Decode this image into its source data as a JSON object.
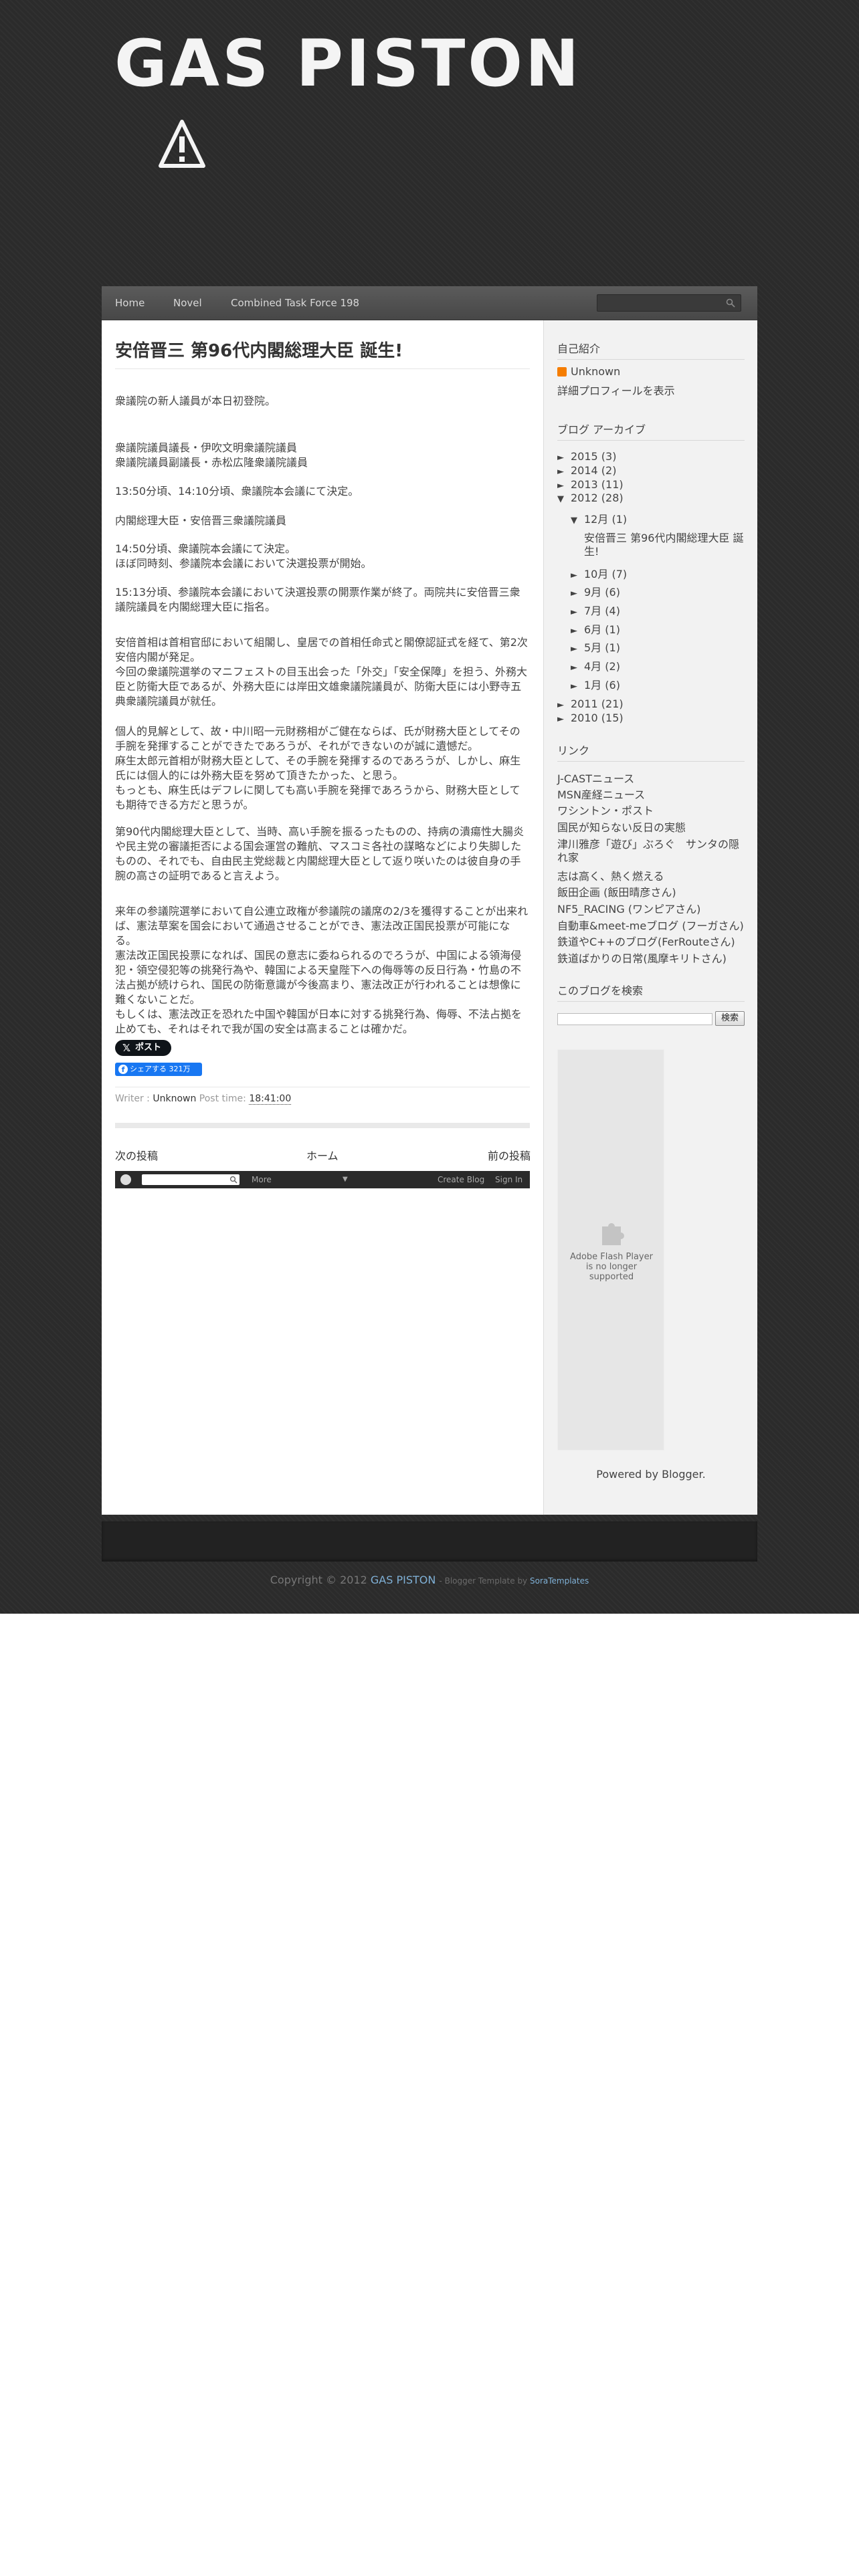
{
  "header": {
    "title": "GAS PISTON"
  },
  "nav": {
    "items": [
      "Home",
      "Novel",
      "Combined Task Force 198"
    ],
    "search_placeholder": ""
  },
  "post": {
    "title": "安倍晋三 第96代内閣総理大臣 誕生!",
    "paragraphs": [
      "衆議院の新人議員が本日初登院。",
      "衆議院議員議長・伊吹文明衆議院議員\n衆議院議員副議長・赤松広隆衆議院議員",
      "13:50分頃、14:10分頃、衆議院本会議にて決定。",
      "内閣総理大臣・安倍晋三衆議院議員",
      "14:50分頃、衆議院本会議にて決定。\nほぼ同時刻、参議院本会議において決選投票が開始。",
      "15:13分頃、参議院本会議において決選投票の開票作業が終了。両院共に安倍晋三衆議院議員を内閣総理大臣に指名。",
      "安倍首相は首相官邸において組閣し、皇居での首相任命式と閣僚認証式を経て、第2次安倍内閣が発足。\n今回の衆議院選挙のマニフェストの目玉出会った「外交」「安全保障」を担う、外務大臣と防衛大臣であるが、外務大臣には岸田文雄衆議院議員が、防衛大臣には小野寺五典衆議院議員が就任。",
      "個人的見解として、故・中川昭一元財務相がご健在ならば、氏が財務大臣としてその手腕を発揮することができたであろうが、それができないのが誠に遺憾だ。\n麻生太郎元首相が財務大臣として、その手腕を発揮するのであろうが、しかし、麻生氏には個人的には外務大臣を努めて頂きたかった、と思う。\nもっとも、麻生氏はデフレに関しても高い手腕を発揮であろうから、財務大臣としても期待できる方だと思うが。",
      "第90代内閣総理大臣として、当時、高い手腕を振るったものの、持病の潰瘍性大腸炎や民主党の審議拒否による国会運営の難航、マスコミ各社の謀略などにより失脚したものの、それでも、自由民主党総裁と内閣総理大臣として返り咲いたのは彼自身の手腕の高さの証明であると言えよう。",
      "来年の参議院選挙において自公連立政権が参議院の議席の2/3を獲得することが出来れば、憲法草案を国会において通過させることができ、憲法改正国民投票が可能になる。\n憲法改正国民投票になれば、国民の意志に委ねられるのでろうが、中国による領海侵犯・領空侵犯等の挑発行為や、韓国による天皇陛下への侮辱等の反日行為・竹島の不法占拠が続けられ、国民の防衛意識が今後高まり、憲法改正が行われることは想像に難くないことだ。\nもしくは、憲法改正を恐れた中国や韓国が日本に対する挑発行為、侮辱、不法占拠を止めても、それはそれで我が国の安全は高まることは確かだ。"
    ],
    "tweet_label": "ポスト",
    "fb_label": "シェアする 321万",
    "writer_label": "Writer :",
    "writer": "Unknown",
    "time_label": "Post time:",
    "time": "18:41:00"
  },
  "pager": {
    "newer": "次の投稿",
    "home": "ホーム",
    "older": "前の投稿"
  },
  "blogger_bar": {
    "more": "More",
    "create": "Create Blog",
    "signin": "Sign In"
  },
  "sidebar": {
    "profile_heading": "自己紹介",
    "profile_name": "Unknown",
    "profile_link": "詳細プロフィールを表示",
    "archive_heading": "ブログ アーカイブ",
    "archive": [
      {
        "arrow": "►",
        "label": "2015 (3)"
      },
      {
        "arrow": "►",
        "label": "2014 (2)"
      },
      {
        "arrow": "►",
        "label": "2013 (11)"
      },
      {
        "arrow": "▼",
        "label": "2012 (28)"
      },
      {
        "arrow": "▼",
        "label": "12月 (1)"
      },
      {
        "arrow": "",
        "label": "安倍晋三 第96代内閣総理大臣 誕生!"
      },
      {
        "arrow": "►",
        "label": "10月 (7)"
      },
      {
        "arrow": "►",
        "label": "9月 (6)"
      },
      {
        "arrow": "►",
        "label": "7月 (4)"
      },
      {
        "arrow": "►",
        "label": "6月 (1)"
      },
      {
        "arrow": "►",
        "label": "5月 (1)"
      },
      {
        "arrow": "►",
        "label": "4月 (2)"
      },
      {
        "arrow": "►",
        "label": "1月 (6)"
      },
      {
        "arrow": "►",
        "label": "2011 (21)"
      },
      {
        "arrow": "►",
        "label": "2010 (15)"
      }
    ],
    "links_heading": "リンク",
    "links": [
      "J-CASTニュース",
      "MSN産経ニュース",
      "ワシントン・ポスト",
      "国民が知らない反日の実態",
      "津川雅彦「遊び」ぶろぐ　サンタの隠れ家",
      "志は高く、熱く燃える",
      "飯田企画 (飯田晴彦さん)",
      "NF5_RACING (ワンピアさん)",
      "自動車&meet-meブログ (フーガさん)",
      "鉄道やC++のブログ(FerRouteさん)",
      "鉄道ばかりの日常(風摩キリトさん)"
    ],
    "search_heading": "このブログを検索",
    "search_button": "検索",
    "flash_text": "Adobe Flash Player\nis no longer\nsupported",
    "powered": "Powered by Blogger."
  },
  "footer": {
    "copyright": "Copyright © 2012",
    "name": "GAS PISTON",
    "template_prefix": " - Blogger Template by ",
    "template_author": "SoraTemplates"
  }
}
